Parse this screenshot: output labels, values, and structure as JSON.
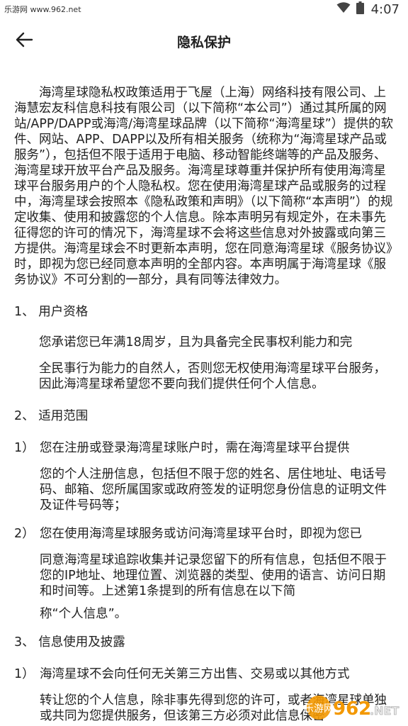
{
  "status_bar": {
    "left_text": "乐游网 www.962.net",
    "time": "4:07",
    "wifi_icon": "wifi-icon",
    "battery_icon": "battery-icon"
  },
  "app_bar": {
    "title": "隐私保护",
    "back_icon": "arrow-left-icon"
  },
  "content": {
    "intro": "海湾星球隐私权政策适用于飞屋（上海）网络科技有限公司、上海慧宏友科信息科技有限公司（以下简称“本公司”）通过其所属的网站/APP/DAPP或海湾/海湾星球品牌（以下简称“海湾星球”）提供的软件、网站、APP、DAPP以及所有相关服务（统称为“海湾星球产品或服务”），包括但不限于适用于电脑、移动智能终端等的产品及服务、海湾星球开放平台产品及服务。海湾星球尊重并保护所有使用海湾星球平台服务用户的个人隐私权。您在使用海湾星球产品或服务的过程中，海湾星球会按照本《隐私政策和声明》（以下简称“本声明”）的规定收集、使用和披露您的个人信息。除本声明另有规定外，在未事先征得您的许可的情况下，海湾星球不会将这些信息对外披露或向第三方提供。海湾星球会不时更新本声明，您在同意海湾星球《服务协议》时，即视为您已经同意本声明的全部内容。本声明属于海湾星球《服务协议》不可分割的一部分，具有同等法律效力。",
    "section1_title": "1、 用户资格",
    "section1_line1": "您承诺您已年满18周岁，且为具备完全民事权利能力和完",
    "section1_line2": "全民事行为能力的自然人，否则您无权使用海湾星球平台服务，因此海湾星球希望您不要向我们提供任何个人信息。",
    "section2_title": "2、 适用范围",
    "item1_num": "1）",
    "item1_line1": "您在注册或登录海湾星球账户时，需在海湾星球平台提供",
    "item1_rest": "您的个人注册信息，包括但不限于您的姓名、居住地址、电话号码、邮箱、您所属国家或政府签发的证明您身份信息的证明文件及证件号码等；",
    "item2_num": "2）",
    "item2_line1": "您在使用海湾星球服务或访问海湾星球平台时，即视为您已",
    "item2_rest": "同意海湾星球追踪收集并记录您留下的所有信息，包括但不限于您的IP地址、地理位置、浏览器的类型、使用的语言、访问日期和时间等。上述第1条提到的所有信息在以下简",
    "item2_last": "称“个人信息”。",
    "section3_title": "3、 信息使用及披露",
    "item3_num": "1）",
    "item3_line1": "海湾星球不会向任何无关第三方出售、交易或以其他方式",
    "item3_rest": "转让您的个人信息，除非事先得到您的许可，或者海湾星球单独或共同为您提供服务，但该第三方必须对此信息保密"
  },
  "watermark": {
    "brand": "962",
    "suffix": ".NET",
    "site": "乐游网"
  }
}
